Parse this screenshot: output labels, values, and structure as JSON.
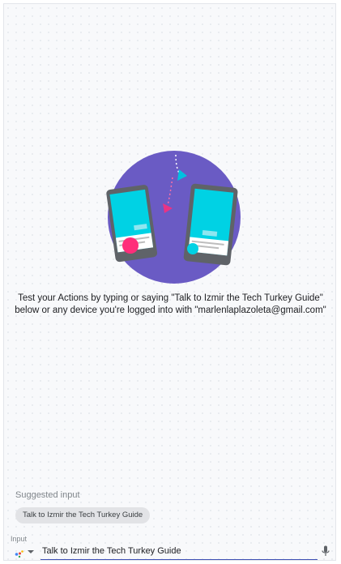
{
  "illustration": {
    "icon": "test-actions-phones-illustration",
    "colors": {
      "circle": "#6a5bc4",
      "phone_frame": "#5f6368",
      "screen": "#00d2e4",
      "accent_pink": "#ff2d7a",
      "accent_cyan": "#00d2e4"
    }
  },
  "description": {
    "line1": "Test your Actions by typing or saying \"Talk to Izmir the Tech Turkey Guide\"",
    "line2": "below or any device you're logged into with \"marlenlaplazoleta@gmail.com\""
  },
  "suggested": {
    "title": "Suggested input",
    "chips": [
      {
        "label": "Talk to Izmir the Tech Turkey Guide"
      }
    ]
  },
  "input": {
    "label": "Input",
    "value": "Talk to Izmir the Tech Turkey Guide",
    "left_icon": "assistant-icon",
    "dropdown_icon": "caret-down-icon",
    "right_icon": "mic-icon",
    "accent": "#3f51b5"
  }
}
